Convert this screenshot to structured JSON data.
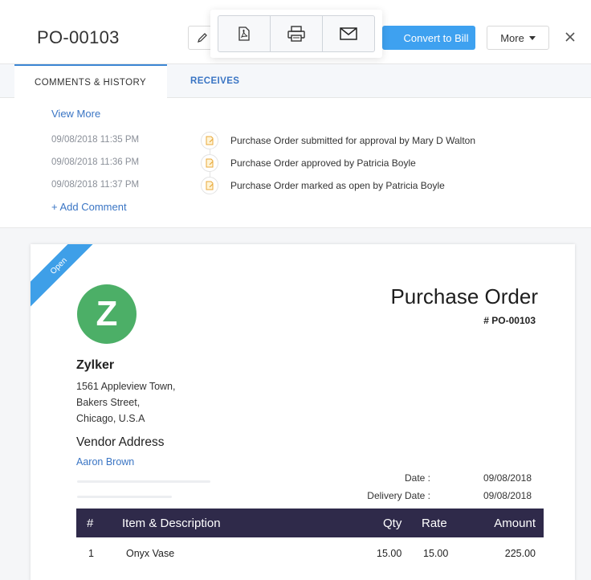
{
  "header": {
    "title": "PO-00103",
    "convert_label": "Convert to Bill",
    "more_label": "More"
  },
  "toolbar": {
    "icons": [
      "pdf-icon",
      "print-icon",
      "mail-icon"
    ]
  },
  "tabs": [
    {
      "label": "COMMENTS & HISTORY",
      "active": true
    },
    {
      "label": "RECEIVES",
      "active": false
    }
  ],
  "history": {
    "view_more": "View More",
    "entries": [
      {
        "time": "09/08/2018  11:35 PM",
        "text": "Purchase Order submitted for approval by Mary D Walton"
      },
      {
        "time": "09/08/2018  11:36 PM",
        "text": "Purchase Order approved by Patricia Boyle"
      },
      {
        "time": "09/08/2018  11:37 PM",
        "text": "Purchase Order marked as open by Patricia Boyle"
      }
    ],
    "add_comment": "+ Add Comment"
  },
  "document": {
    "status": "Open",
    "logo_letter": "Z",
    "company": "Zylker",
    "address": [
      "1561 Appleview Town,",
      "Bakers Street,",
      "Chicago, U.S.A"
    ],
    "title": "Purchase Order",
    "number": "# PO-00103",
    "vendor_label": "Vendor Address",
    "vendor_name": "Aaron Brown",
    "date_label": "Date :",
    "date_value": "09/08/2018",
    "delivery_label": "Delivery Date :",
    "delivery_value": "09/08/2018",
    "table": {
      "headers": [
        "#",
        "Item & Description",
        "Qty",
        "Rate",
        "Amount"
      ],
      "rows": [
        [
          "1",
          "Onyx Vase",
          "15.00",
          "15.00",
          "225.00"
        ]
      ]
    }
  },
  "colors": {
    "accent": "#3ea1f0",
    "link": "#3a75c4",
    "logo": "#4caf67",
    "table_header": "#2f2a4a"
  }
}
